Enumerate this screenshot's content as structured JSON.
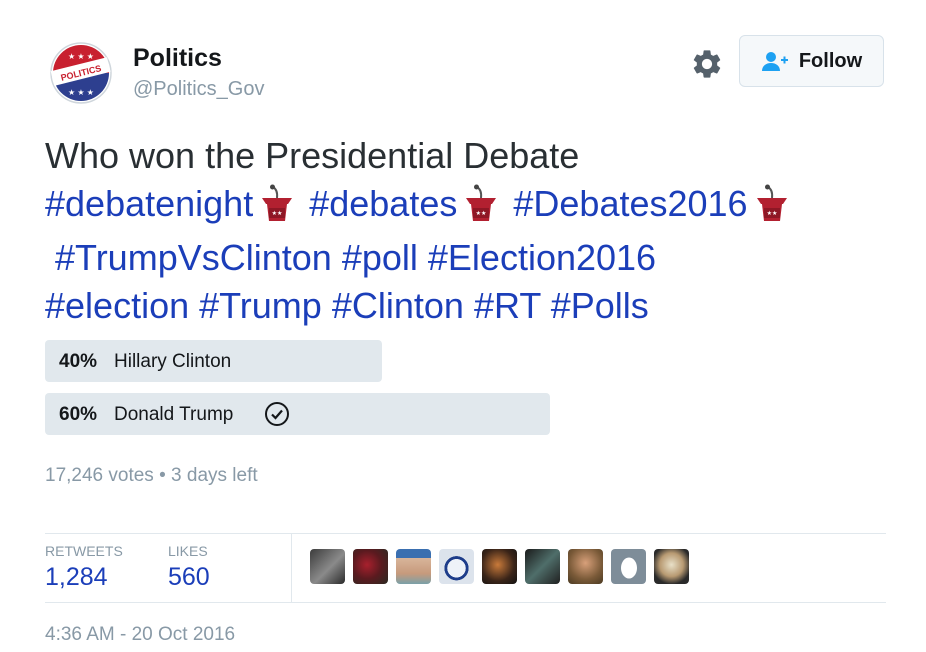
{
  "account": {
    "name": "Politics",
    "handle": "@Politics_Gov",
    "avatar_text": "POLITICS",
    "follow_label": "Follow"
  },
  "tweet": {
    "line1": "Who won the Presidential Debate",
    "tags": [
      "#debatenight",
      "#debates",
      "#Debates2016",
      "#TrumpVsClinton",
      "#poll",
      "#Election2016",
      "#election",
      "#Trump",
      "#Clinton",
      "#RT",
      "#Polls"
    ]
  },
  "poll": {
    "options": [
      {
        "percent": "40%",
        "label": "Hillary Clinton",
        "share": 0.4,
        "winner": false
      },
      {
        "percent": "60%",
        "label": "Donald Trump",
        "share": 0.6,
        "winner": true
      }
    ],
    "votes": "17,246 votes",
    "separator": "•",
    "time_left": "3 days left"
  },
  "stats": {
    "retweets_label": "RETWEETS",
    "retweets": "1,284",
    "likes_label": "LIKES",
    "likes": "560"
  },
  "timestamp": "4:36 AM - 20 Oct 2016",
  "colors": {
    "link": "#1b3eb9",
    "text": "#14171a",
    "muted": "#8899a6",
    "bar": "#e1e8ed",
    "podium": "#b22030"
  }
}
